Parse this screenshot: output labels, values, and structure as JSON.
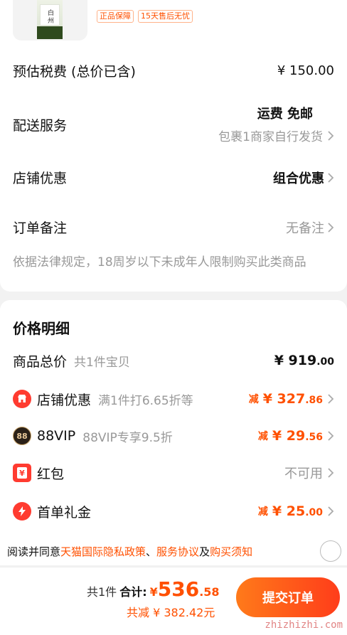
{
  "product": {
    "bottle_text": "白州",
    "tags": [
      "正品保障",
      "15天售后无忧"
    ]
  },
  "order_info": {
    "tax": {
      "label": "预估税费 (总价已含)",
      "value": "¥ 150.00"
    },
    "shipping": {
      "label": "配送服务",
      "value": "运费 免邮",
      "sub": "包裹1商家自行发货"
    },
    "store_discount": {
      "label": "店铺优惠",
      "value": "组合优惠"
    },
    "remark": {
      "label": "订单备注",
      "value": "无备注"
    },
    "notice": "依据法律规定，18周岁以下未成年人限制购买此类商品"
  },
  "price_detail": {
    "title": "价格明细",
    "items": [
      {
        "label": "商品总价",
        "sub": "共1件宝贝",
        "prefix": "",
        "amount": "¥ 919",
        "decimal": ".00"
      },
      {
        "label": "店铺优惠",
        "sub": "满1件打6.65折等",
        "prefix": "减",
        "amount": "¥ 327",
        "decimal": ".86"
      },
      {
        "label": "88VIP",
        "sub": "88VIP专享9.5折",
        "prefix": "减",
        "amount": "¥ 29",
        "decimal": ".56"
      },
      {
        "label": "红包",
        "sub": "",
        "value": "不可用"
      },
      {
        "label": "首单礼金",
        "sub": "",
        "prefix": "减",
        "amount": "¥ 25",
        "decimal": ".00"
      }
    ],
    "icon_88_text": "88",
    "icon_hongbao_text": "¥"
  },
  "agreement": {
    "prefix": "阅读并同意",
    "link1": "天猫国际隐私政策",
    "sep1": "、",
    "link2": "服务协议",
    "sep2": "及",
    "link3": "购买须知"
  },
  "footer": {
    "count": "共1件",
    "total_label": "合计:",
    "currency": "¥",
    "total_int": "536",
    "total_dec": ".58",
    "saved": "共减 ¥ 382.42元",
    "submit_label": "提交订单",
    "watermark": "zhizhizhi.com"
  },
  "colors": {
    "accent": "#ff5000",
    "vip": "#2b2118",
    "hongbao": "#ff3b30",
    "lightning": "#ff3b30"
  }
}
